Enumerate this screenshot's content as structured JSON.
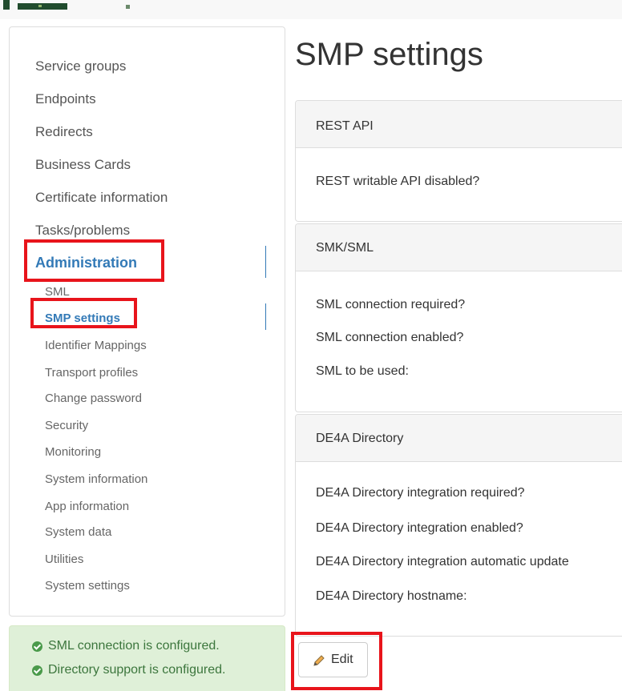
{
  "sidebar": {
    "items": [
      {
        "label": "Service groups"
      },
      {
        "label": "Endpoints"
      },
      {
        "label": "Redirects"
      },
      {
        "label": "Business Cards"
      },
      {
        "label": "Certificate information"
      },
      {
        "label": "Tasks/problems"
      },
      {
        "label": "Administration",
        "active": true
      }
    ],
    "admin_subitems": [
      {
        "label": "SML"
      },
      {
        "label": "SMP settings",
        "active": true
      },
      {
        "label": "Identifier Mappings"
      },
      {
        "label": "Transport profiles"
      },
      {
        "label": "Change password"
      },
      {
        "label": "Security"
      },
      {
        "label": "Monitoring"
      },
      {
        "label": "System information"
      },
      {
        "label": "App information"
      },
      {
        "label": "System data"
      },
      {
        "label": "Utilities"
      },
      {
        "label": "System settings"
      }
    ]
  },
  "status": {
    "lines": [
      "SML connection is configured.",
      "Directory support is configured."
    ]
  },
  "main": {
    "title": "SMP settings",
    "panels": [
      {
        "heading": "REST API",
        "rows": [
          "REST writable API disabled?"
        ]
      },
      {
        "heading": "SMK/SML",
        "rows": [
          "SML connection required?",
          "SML connection enabled?",
          "SML to be used:"
        ]
      },
      {
        "heading": "DE4A Directory",
        "rows": [
          "DE4A Directory integration required?",
          "DE4A Directory integration enabled?",
          "DE4A Directory integration automatic update",
          "DE4A Directory hostname:"
        ]
      }
    ],
    "edit_label": "Edit"
  },
  "colors": {
    "accent": "#337ab7",
    "highlight": "#e8141b",
    "success_bg": "#dff0d8",
    "success_text": "#3c763d"
  },
  "icons": {
    "check": "check-circle-icon",
    "edit": "pencil-icon"
  }
}
